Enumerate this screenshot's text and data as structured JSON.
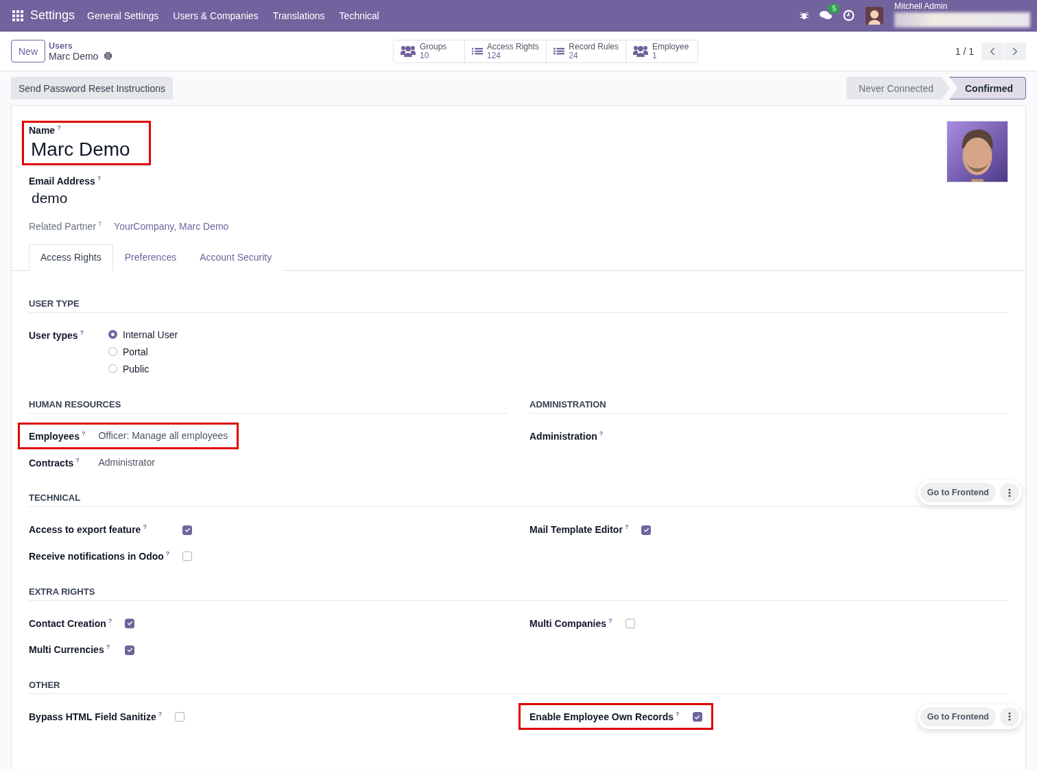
{
  "navbar": {
    "app_name": "Settings",
    "menu": [
      "General Settings",
      "Users & Companies",
      "Translations",
      "Technical"
    ],
    "message_count": "5",
    "user_name": "Mitchell Admin"
  },
  "control_panel": {
    "new_label": "New",
    "breadcrumb_parent": "Users",
    "breadcrumb_current": "Marc Demo",
    "smart_buttons": [
      {
        "kind": "group",
        "label": "Groups",
        "count": "10"
      },
      {
        "kind": "list",
        "label": "Access Rights",
        "count": "124"
      },
      {
        "kind": "bullets",
        "label": "Record Rules",
        "count": "24"
      },
      {
        "kind": "group",
        "label": "Employee",
        "count": "1"
      }
    ],
    "pager": "1 / 1"
  },
  "action_button": "Send Password Reset Instructions",
  "status_bar": [
    {
      "label": "Never Connected",
      "selected": false
    },
    {
      "label": "Confirmed",
      "selected": true
    }
  ],
  "form": {
    "name_label": "Name",
    "name_help": "?",
    "name": "Marc Demo",
    "name_highlighted": true,
    "email_label": "Email Address",
    "email_help": "?",
    "email": "demo",
    "partner_label": "Related Partner",
    "partner_help": "?",
    "partner": "YourCompany, Marc Demo"
  },
  "tabs": [
    {
      "label": "Access Rights",
      "selected": true
    },
    {
      "label": "Preferences",
      "selected": false
    },
    {
      "label": "Account Security",
      "selected": false
    }
  ],
  "sections": [
    {
      "title": "USER TYPE",
      "columns": [
        {
          "fields": [
            {
              "kind": "radio",
              "label": "User types",
              "help": "?",
              "options": [
                {
                  "label": "Internal User",
                  "selected": true
                },
                {
                  "label": "Portal",
                  "selected": false
                },
                {
                  "label": "Public",
                  "selected": false
                }
              ],
              "highlighted": false
            }
          ]
        }
      ]
    },
    {
      "columns": [
        {
          "title": "HUMAN RESOURCES",
          "fields": [
            {
              "kind": "text",
              "label": "Employees",
              "help": "?",
              "value": "Officer: Manage all employees",
              "highlighted": true
            },
            {
              "kind": "text",
              "label": "Contracts",
              "help": "?",
              "value": "Administrator",
              "highlighted": false
            }
          ]
        },
        {
          "title": "ADMINISTRATION",
          "fields": [
            {
              "kind": "text",
              "label": "Administration",
              "help": "?",
              "highlighted": false
            }
          ]
        }
      ],
      "floating_button": "Go to Frontend"
    },
    {
      "title": "TECHNICAL",
      "columns": [
        {
          "fields": [
            {
              "kind": "checkbox",
              "label": "Access to export feature",
              "help": "?",
              "checked": true,
              "highlighted": false
            },
            {
              "kind": "checkbox",
              "label": "Receive notifications in Odoo",
              "help": "?",
              "checked": false,
              "highlighted": false
            }
          ]
        },
        {
          "fields": [
            {
              "kind": "checkbox",
              "label": "Mail Template Editor",
              "help": "?",
              "checked": true,
              "highlighted": false
            }
          ]
        }
      ]
    },
    {
      "title": "EXTRA RIGHTS",
      "columns": [
        {
          "fields": [
            {
              "kind": "checkbox",
              "label": "Contact Creation",
              "help": "?",
              "checked": true,
              "highlighted": false
            },
            {
              "kind": "checkbox",
              "label": "Multi Currencies",
              "help": "?",
              "checked": true,
              "highlighted": false
            }
          ]
        },
        {
          "fields": [
            {
              "kind": "checkbox",
              "label": "Multi Companies",
              "help": "?",
              "checked": false,
              "highlighted": false
            }
          ]
        }
      ]
    },
    {
      "title": "OTHER",
      "columns": [
        {
          "fields": [
            {
              "kind": "checkbox",
              "label": "Bypass HTML Field Sanitize",
              "help": "?",
              "checked": false,
              "highlighted": false
            }
          ]
        },
        {
          "fields": [
            {
              "kind": "checkbox",
              "label": "Enable Employee Own Records",
              "help": "?",
              "checked": true,
              "highlighted": true
            }
          ]
        }
      ],
      "floating_button": "Go to Frontend"
    }
  ]
}
